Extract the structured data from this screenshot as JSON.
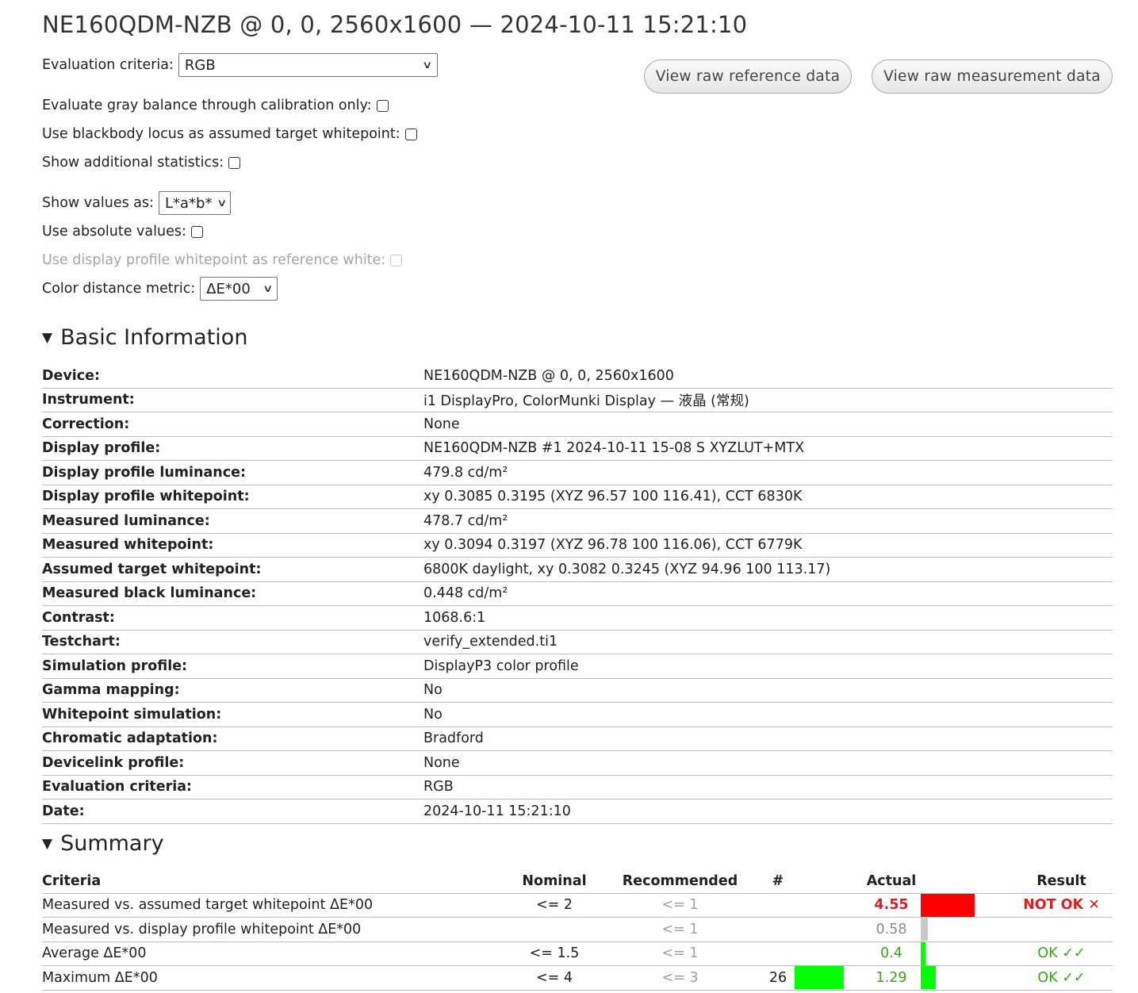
{
  "title": "NE160QDM-NZB @ 0, 0, 2560x1600 — 2024-10-11 15:21:10",
  "controls": {
    "evaluation_criteria_label": "Evaluation criteria:",
    "evaluation_criteria_value": "RGB",
    "gray_balance_label": "Evaluate gray balance through calibration only:",
    "blackbody_label": "Use blackbody locus as assumed target whitepoint:",
    "additional_stats_label": "Show additional statistics:",
    "show_values_label": "Show values as:",
    "show_values_value": "L*a*b*",
    "absolute_label": "Use absolute values:",
    "profile_whitepoint_label": "Use display profile whitepoint as reference white:",
    "distance_metric_label": "Color distance metric:",
    "distance_metric_value": "ΔE*00"
  },
  "buttons": {
    "raw_reference": "View raw reference data",
    "raw_measurement": "View raw measurement data"
  },
  "basic_info": {
    "title": "Basic Information",
    "rows": [
      {
        "key": "Device:",
        "value": "NE160QDM-NZB @ 0, 0, 2560x1600"
      },
      {
        "key": "Instrument:",
        "value": "i1 DisplayPro, ColorMunki Display — 液晶 (常规)"
      },
      {
        "key": "Correction:",
        "value": "None"
      },
      {
        "key": "Display profile:",
        "value": "NE160QDM-NZB #1 2024-10-11 15-08 S XYZLUT+MTX"
      },
      {
        "key": "Display profile luminance:",
        "value": "479.8 cd/m²"
      },
      {
        "key": "Display profile whitepoint:",
        "value": "xy 0.3085 0.3195 (XYZ 96.57 100 116.41), CCT 6830K"
      },
      {
        "key": "Measured luminance:",
        "value": "478.7 cd/m²"
      },
      {
        "key": "Measured whitepoint:",
        "value": "xy 0.3094 0.3197 (XYZ 96.78 100 116.06), CCT 6779K"
      },
      {
        "key": "Assumed target whitepoint:",
        "value": "6800K daylight, xy 0.3082 0.3245 (XYZ 94.96 100 113.17)"
      },
      {
        "key": "Measured black luminance:",
        "value": "0.448 cd/m²"
      },
      {
        "key": "Contrast:",
        "value": "1068.6:1"
      },
      {
        "key": "Testchart:",
        "value": "verify_extended.ti1"
      },
      {
        "key": "Simulation profile:",
        "value": "DisplayP3 color profile"
      },
      {
        "key": "Gamma mapping:",
        "value": "No"
      },
      {
        "key": "Whitepoint simulation:",
        "value": "No"
      },
      {
        "key": "Chromatic adaptation:",
        "value": "Bradford"
      },
      {
        "key": "Devicelink profile:",
        "value": "None"
      },
      {
        "key": "Evaluation criteria:",
        "value": "RGB"
      },
      {
        "key": "Date:",
        "value": "2024-10-11 15:21:10"
      }
    ]
  },
  "summary": {
    "title": "Summary",
    "headers": {
      "criteria": "Criteria",
      "nominal": "Nominal",
      "recommended": "Recommended",
      "count": "#",
      "actual": "Actual",
      "result": "Result"
    },
    "rows": [
      {
        "criteria": "Measured vs. assumed target whitepoint ΔE*00",
        "nominal": "<= 2",
        "recommended": "<= 1",
        "count": "",
        "count_bar": 0,
        "actual": "4.55",
        "actual_bar": 1.0,
        "bar_color": "#ff0000",
        "result": "NOT OK ✕",
        "status": "fail"
      },
      {
        "criteria": "Measured vs. display profile whitepoint ΔE*00",
        "nominal": "",
        "recommended": "<= 1",
        "count": "",
        "count_bar": 0,
        "actual": "0.58",
        "actual_bar": 0.13,
        "bar_color": "#c8c8c8",
        "result": "",
        "status": "neutral"
      },
      {
        "criteria": "Average ΔE*00",
        "nominal": "<= 1.5",
        "recommended": "<= 1",
        "count": "",
        "count_bar": 0,
        "actual": "0.4",
        "actual_bar": 0.09,
        "bar_color": "#00ff00",
        "result": "OK ✓✓",
        "status": "pass"
      },
      {
        "criteria": "Maximum ΔE*00",
        "nominal": "<= 4",
        "recommended": "<= 3",
        "count": "26",
        "count_bar": 0.86,
        "actual": "1.29",
        "actual_bar": 0.28,
        "bar_color": "#00ff00",
        "result": "OK ✓✓",
        "status": "pass"
      }
    ]
  }
}
